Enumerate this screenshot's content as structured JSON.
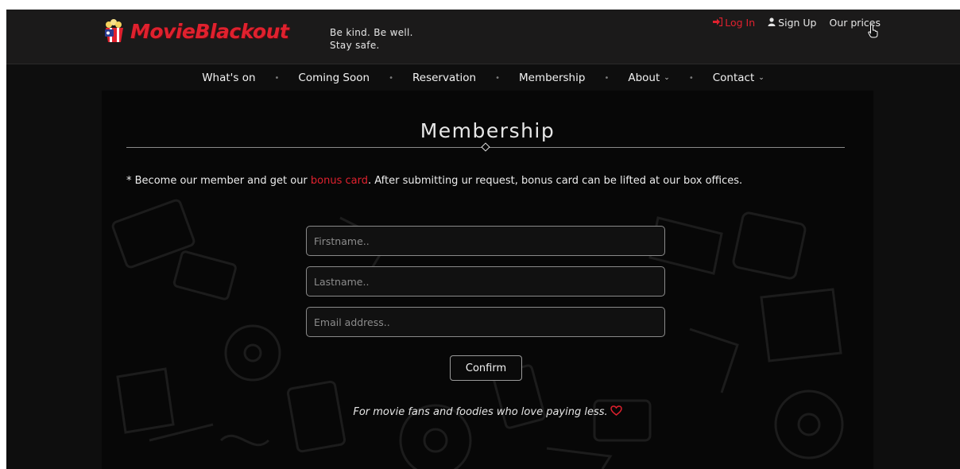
{
  "header": {
    "brand": "MovieBlackout",
    "tagline_line1": "Be kind. Be well.",
    "tagline_line2": "Stay safe.",
    "login_label": "Log In",
    "signup_label": "Sign Up",
    "prices_label": "Our prices"
  },
  "nav": {
    "items": [
      {
        "label": "What's on"
      },
      {
        "label": "Coming Soon"
      },
      {
        "label": "Reservation"
      },
      {
        "label": "Membership"
      },
      {
        "label": "About"
      },
      {
        "label": "Contact"
      }
    ]
  },
  "main": {
    "title": "Membership",
    "intro_prefix": "* Become our member and get our ",
    "intro_highlight": "bonus card",
    "intro_suffix": ". After submitting ur request, bonus card can be lifted at our box offices.",
    "form": {
      "firstname_placeholder": "Firstname..",
      "lastname_placeholder": "Lastname..",
      "email_placeholder": "Email address..",
      "confirm_label": "Confirm"
    },
    "footer_note": "For movie fans and foodies who love paying less."
  },
  "colors": {
    "accent": "#e0212e",
    "background": "#0e0e0e",
    "topbar": "#1b1a1a"
  }
}
